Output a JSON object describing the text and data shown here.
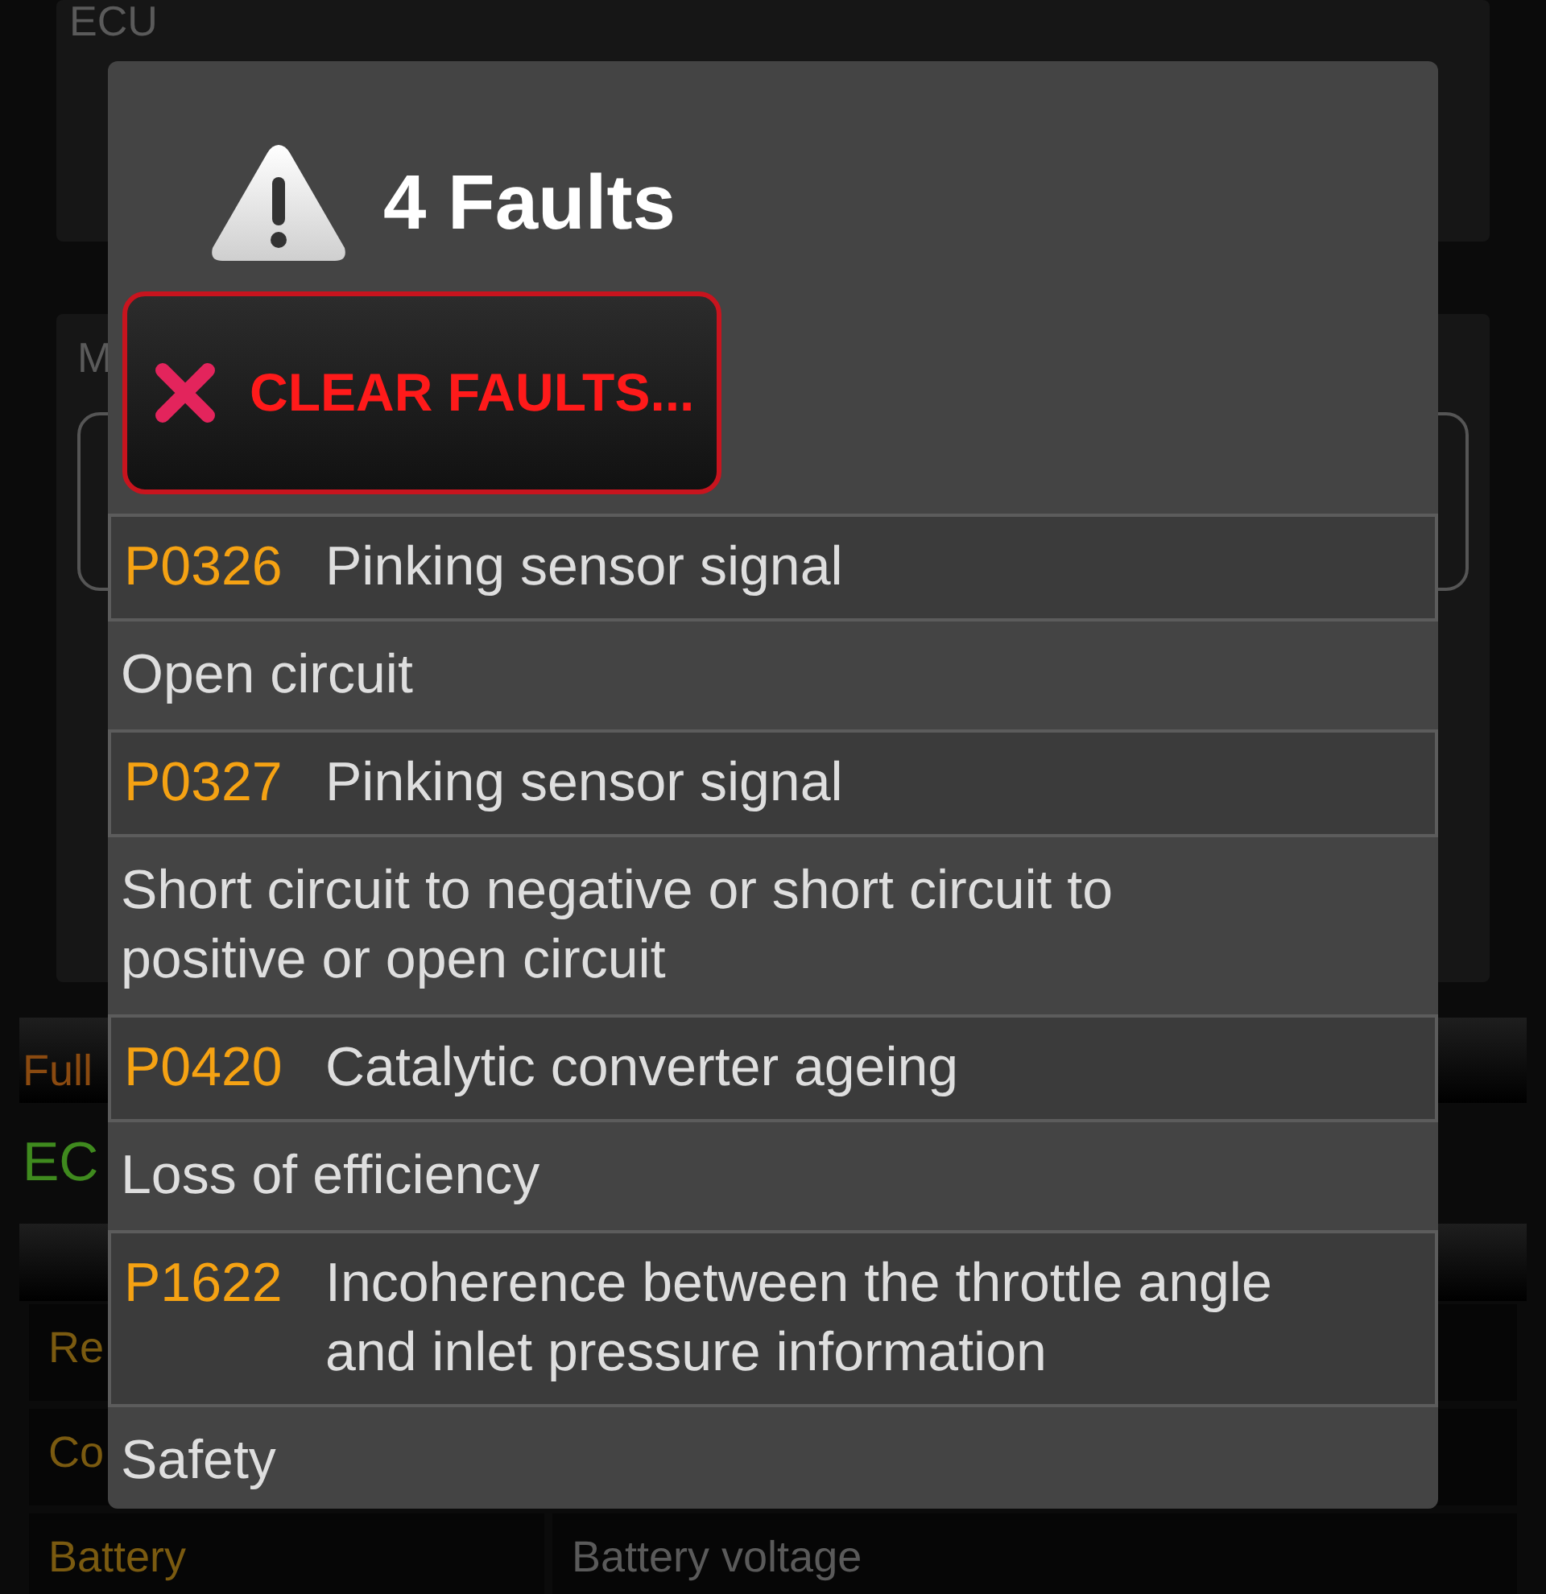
{
  "background": {
    "ecu_card_label": "ECU",
    "module_card_label": "M",
    "status_label": "Full",
    "ecu_status": "EC",
    "rows": [
      {
        "label": "Re"
      },
      {
        "label": "Co"
      },
      {
        "label": "Battery",
        "value": "Battery voltage"
      }
    ]
  },
  "dialog": {
    "title": "4 Faults",
    "clear_button": "CLEAR FAULTS...",
    "faults": [
      {
        "code": "P0326",
        "name": "Pinking sensor signal",
        "detail": "Open circuit"
      },
      {
        "code": "P0327",
        "name": "Pinking sensor signal",
        "detail": "Short circuit to negative or short circuit to positive or open circuit"
      },
      {
        "code": "P0420",
        "name": "Catalytic converter ageing",
        "detail": "Loss of efficiency"
      },
      {
        "code": "P1622",
        "name": "Incoherence between the throttle angle and inlet pressure information",
        "detail": "Safety"
      }
    ]
  }
}
